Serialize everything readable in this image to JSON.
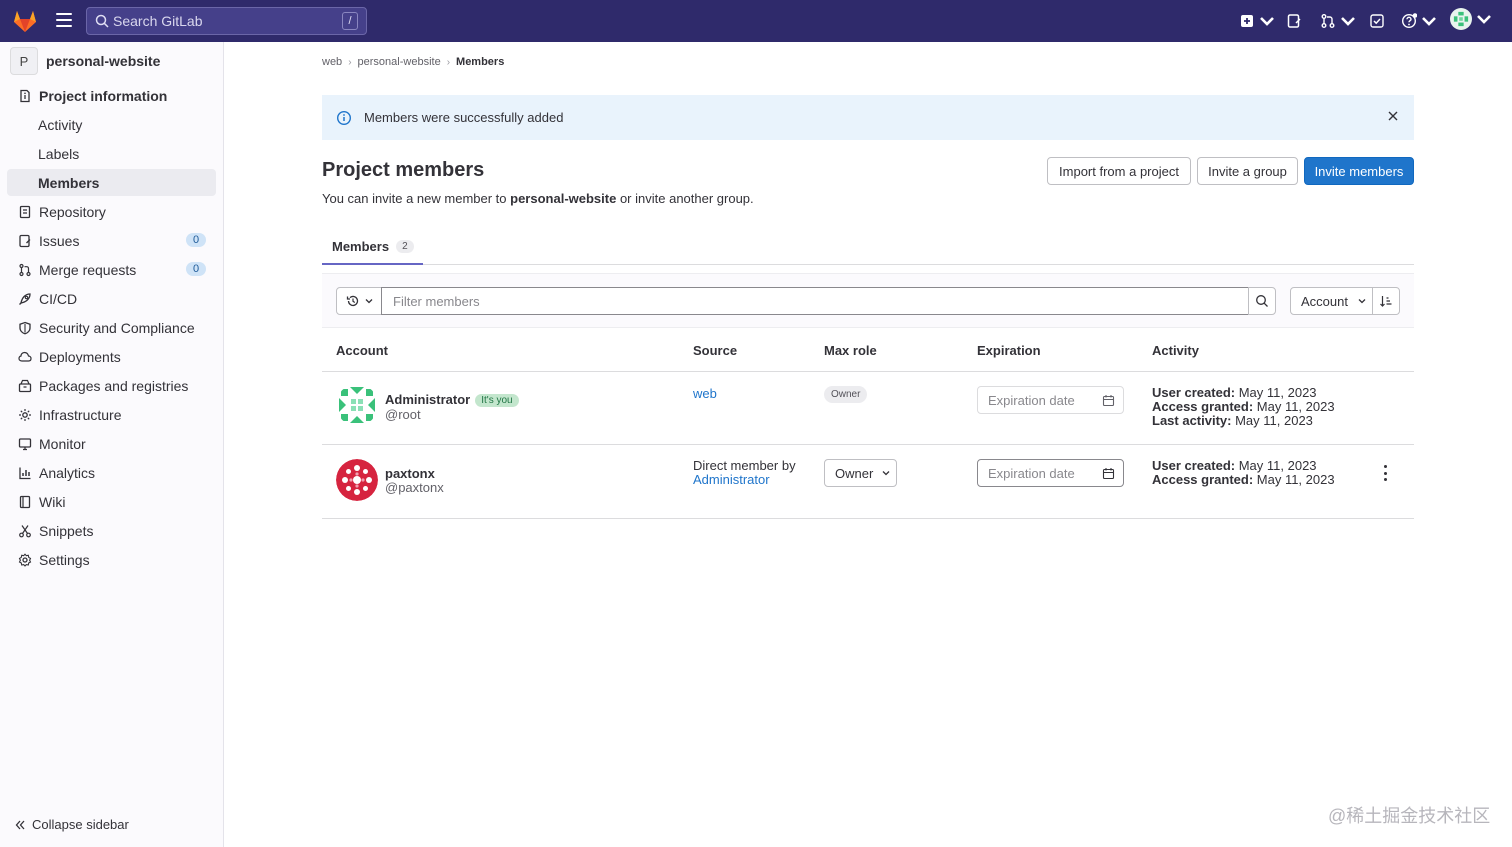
{
  "topbar": {
    "search_placeholder": "Search GitLab",
    "search_shortcut": "/",
    "icons": [
      "gitlab-logo-icon",
      "hamburger-icon",
      "plus-icon",
      "issues-icon",
      "merge-request-icon",
      "todo-icon",
      "help-icon",
      "user-avatar-icon"
    ]
  },
  "sidebar": {
    "project_avatar": "P",
    "project_name": "personal-website",
    "items": [
      {
        "label": "Project information",
        "icon": "info-icon"
      },
      {
        "label": "Activity"
      },
      {
        "label": "Labels"
      },
      {
        "label": "Members"
      },
      {
        "label": "Repository",
        "icon": "doc-icon"
      },
      {
        "label": "Issues",
        "icon": "issues-icon",
        "count": "0"
      },
      {
        "label": "Merge requests",
        "icon": "merge-request-icon",
        "count": "0"
      },
      {
        "label": "CI/CD",
        "icon": "rocket-icon"
      },
      {
        "label": "Security and Compliance",
        "icon": "shield-icon"
      },
      {
        "label": "Deployments",
        "icon": "cloud-icon"
      },
      {
        "label": "Packages and registries",
        "icon": "package-icon"
      },
      {
        "label": "Infrastructure",
        "icon": "cloud-gear-icon"
      },
      {
        "label": "Monitor",
        "icon": "monitor-icon"
      },
      {
        "label": "Analytics",
        "icon": "chart-icon"
      },
      {
        "label": "Wiki",
        "icon": "book-icon"
      },
      {
        "label": "Snippets",
        "icon": "scissors-icon"
      },
      {
        "label": "Settings",
        "icon": "gear-icon"
      }
    ],
    "collapse_label": "Collapse sidebar"
  },
  "breadcrumb": [
    "web",
    "personal-website",
    "Members"
  ],
  "alert": {
    "message": "Members were successfully added"
  },
  "page": {
    "title": "Project members",
    "desc_prefix": "You can invite a new member to ",
    "desc_project": "personal-website",
    "desc_suffix": " or invite another group."
  },
  "buttons": {
    "import": "Import from a project",
    "invite_group": "Invite a group",
    "invite_members": "Invite members"
  },
  "tabs": [
    {
      "label": "Members",
      "count": "2"
    }
  ],
  "filter": {
    "placeholder": "Filter members",
    "sort_label": "Account"
  },
  "table": {
    "headers": [
      "Account",
      "Source",
      "Max role",
      "Expiration",
      "Activity"
    ],
    "rows": [
      {
        "name": "Administrator",
        "badge": "It's you",
        "handle": "@root",
        "source": "web",
        "role": "Owner",
        "expiration_placeholder": "Expiration date",
        "activity": [
          {
            "label": "User created:",
            "value": " May 11, 2023"
          },
          {
            "label": "Access granted:",
            "value": " May 11, 2023"
          },
          {
            "label": "Last activity:",
            "value": " May 11, 2023"
          }
        ]
      },
      {
        "name": "paxtonx",
        "handle": "@paxtonx",
        "source_prefix": "Direct member by",
        "source_link": "Administrator",
        "role": "Owner",
        "expiration_placeholder": "Expiration date",
        "activity": [
          {
            "label": "User created:",
            "value": " May 11, 2023"
          },
          {
            "label": "Access granted:",
            "value": " May 11, 2023"
          }
        ]
      }
    ]
  },
  "watermark": "@稀土掘金技术社区",
  "colors": {
    "topbar": "#2f2a6b",
    "primary": "#1f75cb",
    "alert_bg": "#e9f3fc",
    "tab_underline": "#6666c4"
  }
}
